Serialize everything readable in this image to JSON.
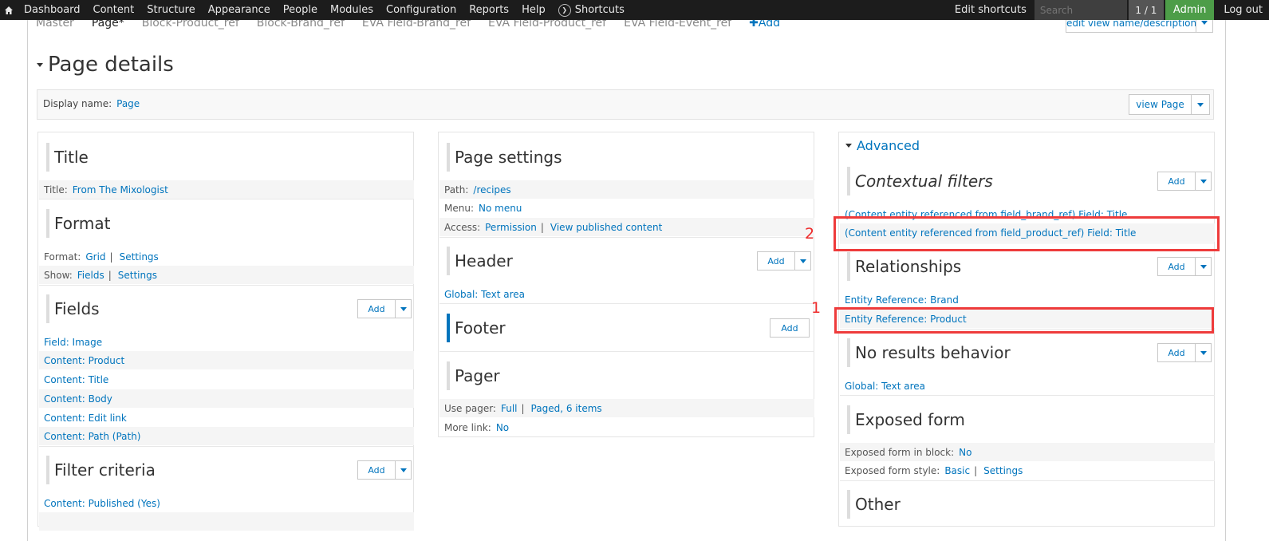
{
  "toolbar": {
    "items": [
      "Dashboard",
      "Content",
      "Structure",
      "Appearance",
      "People",
      "Modules",
      "Configuration",
      "Reports",
      "Help"
    ],
    "shortcuts": "Shortcuts",
    "edit_shortcuts": "Edit shortcuts",
    "search_placeholder": "Search",
    "counter": "1 / 1",
    "admin": "Admin",
    "logout": "Log out"
  },
  "tabs": {
    "items": [
      "Master",
      "Page*",
      "Block-Product_ref",
      "Block-Brand_ref",
      "EVA Field-Brand_ref",
      "EVA Field-Product_ref",
      "EVA Field-Event_ref"
    ],
    "add": "Add",
    "edit_view_name": "edit view name/description"
  },
  "page_details": {
    "title": "Page details",
    "display_name_label": "Display name:",
    "display_name_value": "Page",
    "view_page": "view Page"
  },
  "col1": {
    "title_section": "Title",
    "title_label": "Title:",
    "title_value": "From The Mixologist",
    "format_section": "Format",
    "format_label": "Format:",
    "format_value": "Grid",
    "format_settings": "Settings",
    "show_label": "Show:",
    "show_value": "Fields",
    "show_settings": "Settings",
    "fields_section": "Fields",
    "fields": [
      "Field: Image",
      "Content: Product",
      "Content: Title",
      "Content: Body",
      "Content: Edit link",
      "Content: Path (Path)"
    ],
    "filter_section": "Filter criteria",
    "filters": [
      "Content: Published (Yes)"
    ],
    "add": "Add"
  },
  "col2": {
    "page_settings": "Page settings",
    "path_label": "Path:",
    "path_value": "/recipes",
    "menu_label": "Menu:",
    "menu_value": "No menu",
    "access_label": "Access:",
    "access_value": "Permission",
    "access_detail": "View published content",
    "header_section": "Header",
    "header_item": "Global: Text area",
    "footer_section": "Footer",
    "pager_section": "Pager",
    "use_pager_label": "Use pager:",
    "use_pager_value": "Full",
    "use_pager_detail": "Paged, 6 items",
    "more_link_label": "More link:",
    "more_link_value": "No",
    "add": "Add"
  },
  "col3": {
    "advanced": "Advanced",
    "contextual_section": "Contextual filters",
    "contextual": [
      "(Content entity referenced from field_brand_ref) Field: Title",
      "(Content entity referenced from field_product_ref) Field: Title"
    ],
    "relationships_section": "Relationships",
    "relationships": [
      "Entity Reference: Brand",
      "Entity Reference: Product"
    ],
    "no_results_section": "No results behavior",
    "no_results_item": "Global: Text area",
    "exposed_section": "Exposed form",
    "exposed_block_label": "Exposed form in block:",
    "exposed_block_value": "No",
    "exposed_style_label": "Exposed form style:",
    "exposed_style_value": "Basic",
    "exposed_style_settings": "Settings",
    "other_section": "Other",
    "add": "Add"
  },
  "annotations": {
    "one": "1",
    "two": "2",
    "color": "#ee3b3b"
  },
  "colors": {
    "link": "#0074bd",
    "toolbar": "#1c1c1c",
    "admin_green": "#4d9d48"
  }
}
